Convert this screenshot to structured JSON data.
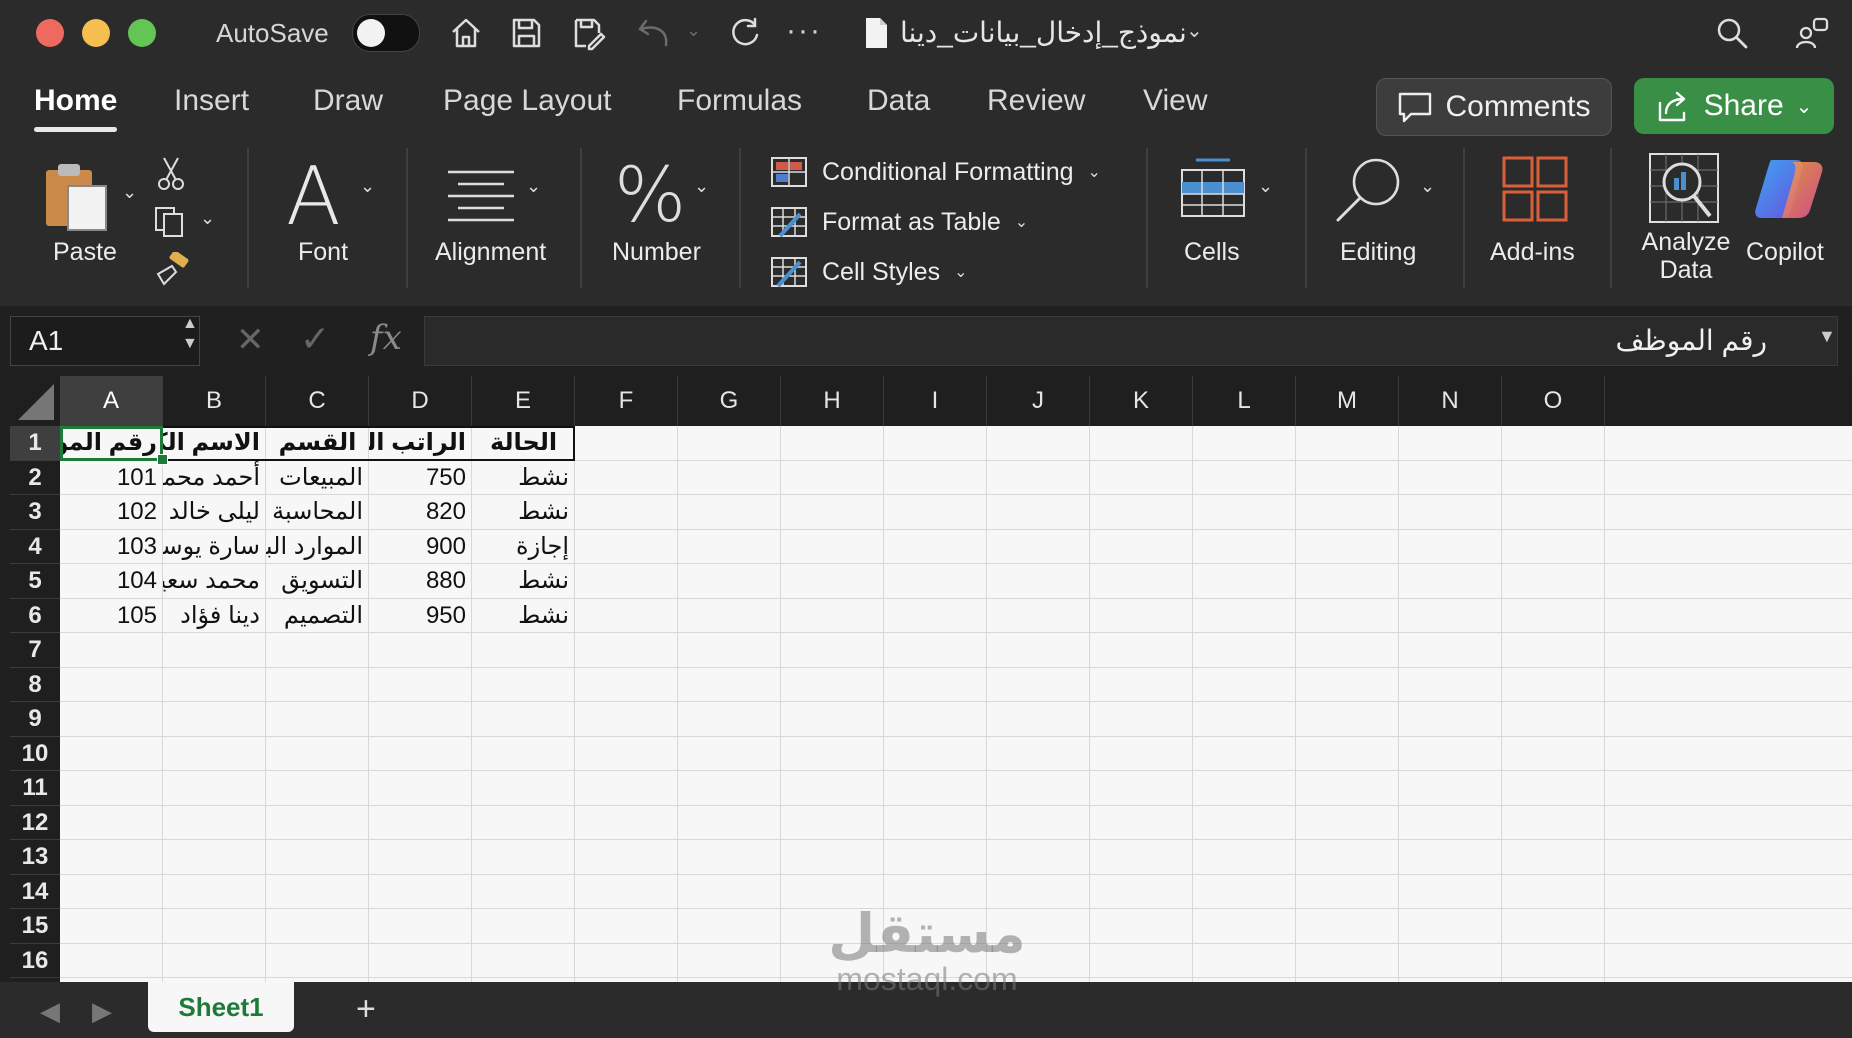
{
  "titlebar": {
    "autosave_label": "AutoSave",
    "doc_title": "نموذج_إدخال_بيانات_دينا",
    "overflow": "···"
  },
  "tabs": [
    {
      "label": "Home",
      "active": true
    },
    {
      "label": "Insert"
    },
    {
      "label": "Draw"
    },
    {
      "label": "Page Layout"
    },
    {
      "label": "Formulas"
    },
    {
      "label": "Data"
    },
    {
      "label": "Review"
    },
    {
      "label": "View"
    }
  ],
  "actions": {
    "comments": "Comments",
    "share": "Share"
  },
  "ribbon": {
    "paste": "Paste",
    "font": "Font",
    "alignment": "Alignment",
    "number": "Number",
    "conditional_formatting": "Conditional Formatting",
    "format_as_table": "Format as Table",
    "cell_styles": "Cell Styles",
    "cells": "Cells",
    "editing": "Editing",
    "addins": "Add-ins",
    "analyze_data": "Analyze Data",
    "copilot": "Copilot"
  },
  "formula_bar": {
    "name_box": "A1",
    "fx": "fx",
    "content": "رقم الموظف"
  },
  "columns": [
    "A",
    "B",
    "C",
    "D",
    "E",
    "F",
    "G",
    "H",
    "I",
    "J",
    "K",
    "L",
    "M",
    "N",
    "O"
  ],
  "rows": [
    "1",
    "2",
    "3",
    "4",
    "5",
    "6",
    "7",
    "8",
    "9",
    "10",
    "11",
    "12",
    "13",
    "14",
    "15",
    "16"
  ],
  "sheet": {
    "headers": [
      "رقم الموظف",
      "الاسم الكامل",
      "القسم",
      "الراتب الشهري (",
      "الحالة"
    ],
    "data": [
      [
        "101",
        "أحمد محمد",
        "المبيعات",
        "750",
        "نشط"
      ],
      [
        "102",
        "ليلى خالد",
        "المحاسبة",
        "820",
        "نشط"
      ],
      [
        "103",
        "سارة يوسف",
        "الموارد البشرية",
        "900",
        "إجازة"
      ],
      [
        "104",
        "محمد سعيد",
        "التسويق",
        "880",
        "نشط"
      ],
      [
        "105",
        "دينا فؤاد",
        "التصميم",
        "950",
        "نشط"
      ]
    ]
  },
  "sheet_tabs": {
    "active": "Sheet1",
    "add": "+"
  },
  "watermark": {
    "ar": "مستقل",
    "en": "mostaql.com"
  },
  "colors": {
    "accent_green": "#1f7a3a",
    "share_green": "#3a8f46"
  }
}
